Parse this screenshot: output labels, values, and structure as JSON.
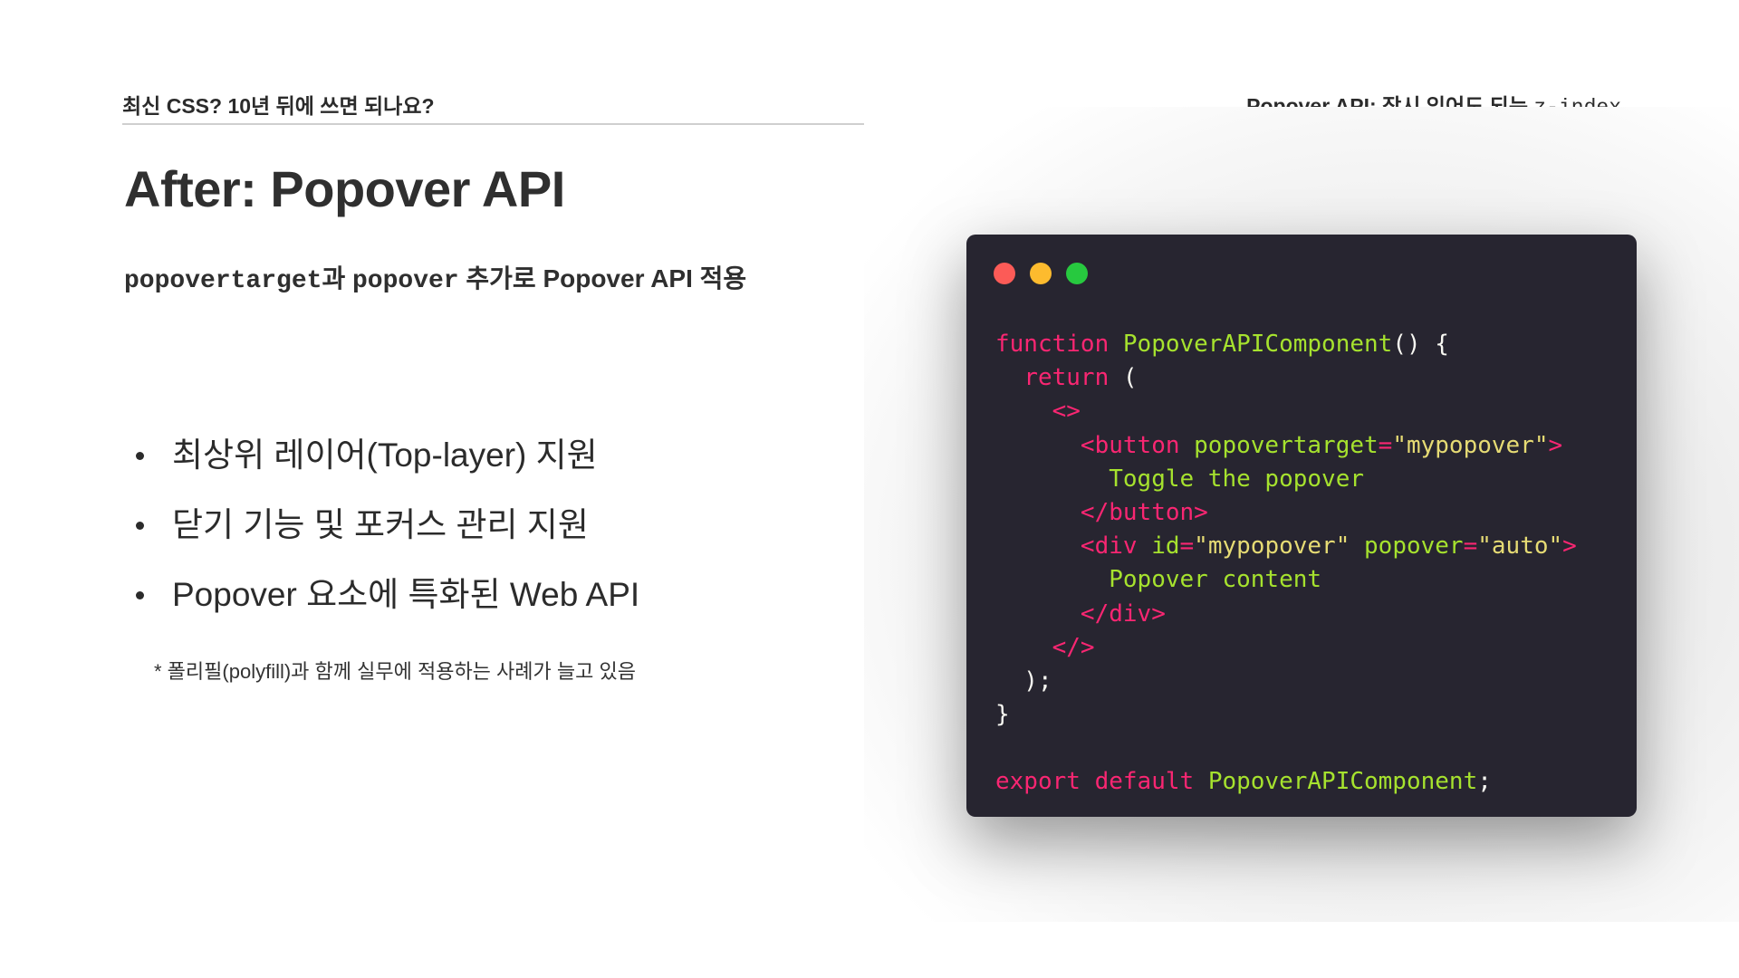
{
  "header": {
    "left": "최신 CSS? 10년 뒤에 쓰면 되나요?",
    "right_text": "Popover API: 잠시 잊어도 되는 ",
    "right_code": "z-index"
  },
  "slide": {
    "title": "After: Popover API",
    "subtitle": {
      "code1": "popovertarget",
      "text1": "과 ",
      "code2": "popover",
      "text2": " 추가로 Popover API 적용"
    },
    "bullets": [
      "최상위 레이어(Top-layer) 지원",
      "닫기 기능 및 포커스 관리 지원",
      "Popover 요소에 특화된 Web API"
    ],
    "footnote": "* 폴리필(polyfill)과 함께 실무에 적용하는 사례가 늘고 있음"
  },
  "code": {
    "window_controls": [
      "red-dot",
      "yellow-dot",
      "green-dot"
    ],
    "colors": {
      "keyword": "#f92672",
      "function": "#a6e22e",
      "string": "#e6db74",
      "plain": "#f8f8f2",
      "background": "#272530"
    },
    "lines": [
      [
        {
          "t": "function",
          "c": "k"
        },
        {
          "t": " ",
          "c": "p"
        },
        {
          "t": "PopoverAPIComponent",
          "c": "f"
        },
        {
          "t": "() {",
          "c": "p"
        }
      ],
      [
        {
          "t": "  ",
          "c": "p"
        },
        {
          "t": "return",
          "c": "k"
        },
        {
          "t": " (",
          "c": "p"
        }
      ],
      [
        {
          "t": "    ",
          "c": "p"
        },
        {
          "t": "<>",
          "c": "k"
        }
      ],
      [
        {
          "t": "      ",
          "c": "p"
        },
        {
          "t": "<button",
          "c": "k"
        },
        {
          "t": " ",
          "c": "p"
        },
        {
          "t": "popovertarget",
          "c": "f"
        },
        {
          "t": "=",
          "c": "k"
        },
        {
          "t": "\"mypopover\"",
          "c": "s"
        },
        {
          "t": ">",
          "c": "k"
        }
      ],
      [
        {
          "t": "        ",
          "c": "p"
        },
        {
          "t": "Toggle the popover",
          "c": "f"
        }
      ],
      [
        {
          "t": "      ",
          "c": "p"
        },
        {
          "t": "</button>",
          "c": "k"
        }
      ],
      [
        {
          "t": "      ",
          "c": "p"
        },
        {
          "t": "<div",
          "c": "k"
        },
        {
          "t": " ",
          "c": "p"
        },
        {
          "t": "id",
          "c": "f"
        },
        {
          "t": "=",
          "c": "k"
        },
        {
          "t": "\"mypopover\"",
          "c": "s"
        },
        {
          "t": " ",
          "c": "p"
        },
        {
          "t": "popover",
          "c": "f"
        },
        {
          "t": "=",
          "c": "k"
        },
        {
          "t": "\"auto\"",
          "c": "s"
        },
        {
          "t": ">",
          "c": "k"
        }
      ],
      [
        {
          "t": "        ",
          "c": "p"
        },
        {
          "t": "Popover content",
          "c": "f"
        }
      ],
      [
        {
          "t": "      ",
          "c": "p"
        },
        {
          "t": "</div>",
          "c": "k"
        }
      ],
      [
        {
          "t": "    ",
          "c": "p"
        },
        {
          "t": "</>",
          "c": "k"
        }
      ],
      [
        {
          "t": "  );",
          "c": "p"
        }
      ],
      [
        {
          "t": "}",
          "c": "p"
        }
      ],
      [],
      [
        {
          "t": "export",
          "c": "k"
        },
        {
          "t": " ",
          "c": "p"
        },
        {
          "t": "default",
          "c": "k"
        },
        {
          "t": " ",
          "c": "p"
        },
        {
          "t": "PopoverAPIComponent",
          "c": "f"
        },
        {
          "t": ";",
          "c": "p"
        }
      ]
    ]
  }
}
